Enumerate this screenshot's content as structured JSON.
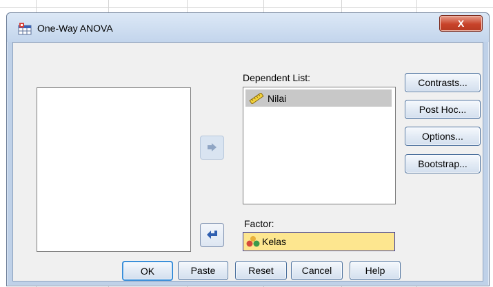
{
  "window": {
    "title": "One-Way ANOVA",
    "close_glyph": "X"
  },
  "labels": {
    "dependent_list": "Dependent List:",
    "factor": "Factor:"
  },
  "dependent_list": {
    "items": [
      "Nilai"
    ]
  },
  "factor": {
    "value": "Kelas"
  },
  "side_buttons": [
    {
      "label": "Contrasts..."
    },
    {
      "label": "Post Hoc..."
    },
    {
      "label": "Options..."
    },
    {
      "label": "Bootstrap..."
    }
  ],
  "bottom_buttons": {
    "ok": "OK",
    "paste": "Paste",
    "reset": "Reset",
    "cancel": "Cancel",
    "help": "Help"
  },
  "icons": {
    "app": "spss-dialog-icon",
    "scale_variable": "ruler-icon",
    "nominal_variable": "people-icon",
    "move_right": "arrow-right-icon",
    "move_left": "arrow-left-icon"
  },
  "colors": {
    "factor_fill": "#fde68f",
    "selected_item": "#c8c8c8",
    "close_red": "#c8432a"
  }
}
